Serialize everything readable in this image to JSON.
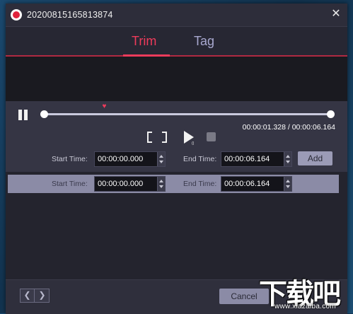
{
  "window": {
    "title": "20200815165813874",
    "close_glyph": "✕",
    "app_icon": "record-icon"
  },
  "tabs": [
    {
      "label": "Trim",
      "active": true
    },
    {
      "label": "Tag",
      "active": false
    }
  ],
  "colors": {
    "accent": "#ee3b5b",
    "tab_inactive": "#a8a8cf",
    "panel": "#2a2a36"
  },
  "player": {
    "current_time": "00:00:01.328",
    "separator": "/",
    "total_time": "00:00:06.164",
    "playhead_fraction": 0.2155,
    "pause_icon": "pause-icon",
    "play_icon": "play-icon",
    "stop_icon": "stop-icon",
    "mark_in_icon": "bracket-left-icon",
    "mark_out_icon": "bracket-right-icon"
  },
  "trim_input": {
    "start_label": "Start Time:",
    "start_value": "00:00:00.000",
    "end_label": "End Time:",
    "end_value": "00:00:06.164",
    "add_label": "Add"
  },
  "segments": [
    {
      "start_label": "Start Time:",
      "start_value": "00:00:00.000",
      "end_label": "End Time:",
      "end_value": "00:00:06.164"
    }
  ],
  "footer": {
    "prev_glyph": "❮",
    "next_glyph": "❯",
    "cancel_label": "Cancel"
  },
  "watermark": {
    "text": "下载吧",
    "url": "www.xiazaiba.com"
  }
}
